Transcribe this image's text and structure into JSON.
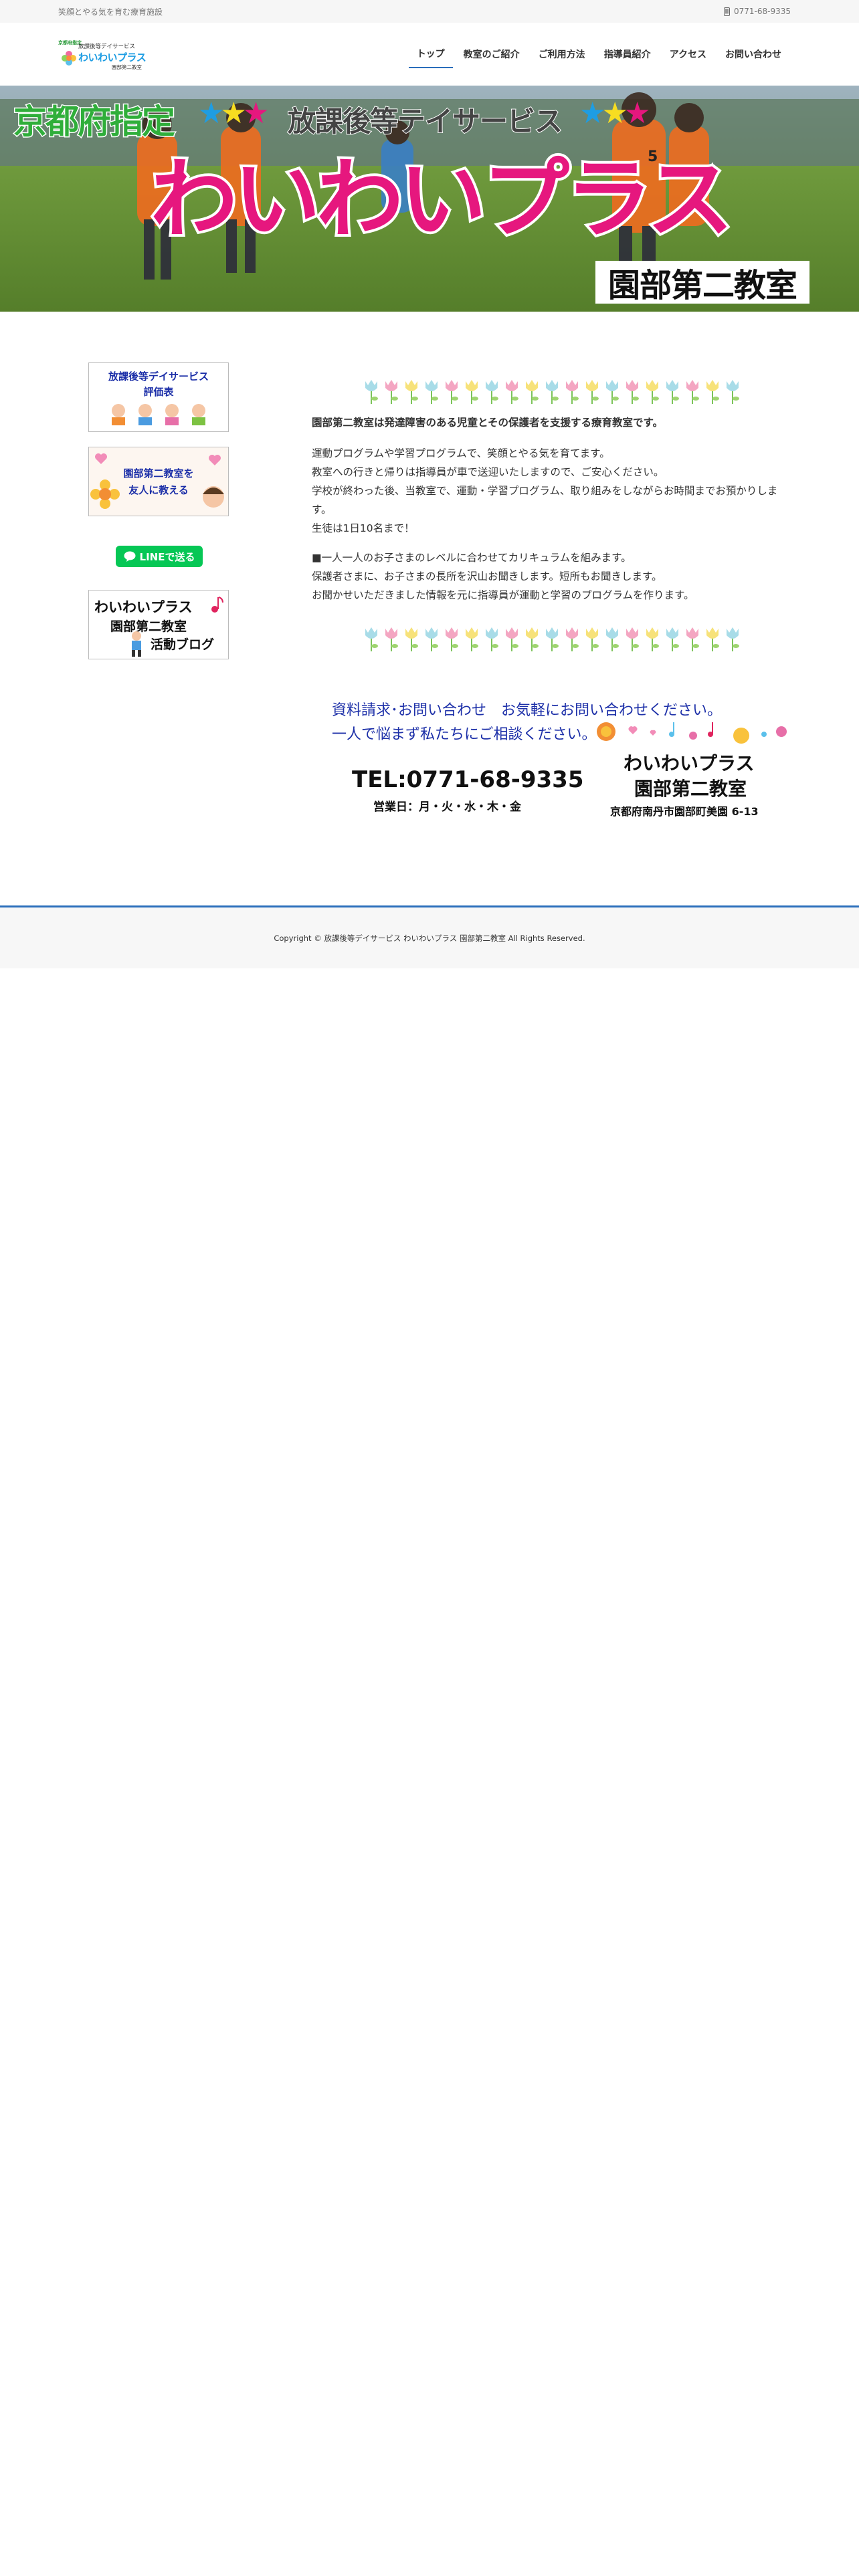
{
  "topbar": {
    "tagline": "笑顔とやる気を育む療育施設",
    "phone": "0771-68-9335"
  },
  "logo": {
    "small_text": "京都府指定",
    "line1": "放課後等デイサービス",
    "name": "わいわいプラス",
    "sub": "園部第二教室"
  },
  "nav": [
    {
      "label": "トップ"
    },
    {
      "label": "教室のご紹介"
    },
    {
      "label": "ご利用方法"
    },
    {
      "label": "指導員紹介"
    },
    {
      "label": "アクセス"
    },
    {
      "label": "お問い合わせ"
    }
  ],
  "hero": {
    "prefecture": "京都府指定",
    "service": "放課後等テイサービス",
    "title": "わいわいプラス",
    "branch": "園部第二教室",
    "bib_number": "5"
  },
  "sidebar": {
    "banner1": {
      "line1": "放課後等デイサービス",
      "line2": "評価表"
    },
    "banner2": {
      "line1": "園部第二教室を",
      "line2": "友人に教える"
    },
    "line_button": "LINEで送る",
    "banner3": {
      "line1": "わいわいプラス",
      "line2": "園部第二教室",
      "line3": "活動ブログ"
    }
  },
  "main": {
    "lead": "園部第二教室は発達障害のある児童とその保護者を支援する療育教室です。",
    "para1": [
      "運動プログラムや学習プログラムで、笑顔とやる気を育てます。",
      "教室への行きと帰りは指導員が車で送迎いたしますので、ご安心ください。",
      "学校が終わった後、当教室で、運動・学習プログラム、取り組みをしながらお時間までお預かりしま",
      "す。",
      "生徒は1日10名まで！"
    ],
    "para2": [
      "■一人一人のお子さまのレベルに合わせてカリキュラムを組みます。",
      "保護者さまに、お子さまの長所を沢山お聞きします。短所もお聞きします。",
      "お聞かせいただきました情報を元に指導員が運動と学習のプログラムを作ります。"
    ]
  },
  "contact": {
    "line1": "資料請求･お問い合わせ　お気軽にお問い合わせください。",
    "line2": "一人で悩まず私たちにご相談ください。",
    "tel": "TEL:0771-68-9335",
    "days": "営業日：月・火・水・木・金",
    "name": "わいわいプラス",
    "branch": "園部第二教室",
    "address": "京都府南丹市園部町美園 6-13"
  },
  "footer": {
    "copyright": "Copyright © 放課後等デイサービス わいわいプラス 園部第二教室 All Rights Reserved."
  },
  "colors": {
    "accent": "#2a6ebb",
    "line_green": "#06c755",
    "contact_blue": "#1c2fa8"
  }
}
